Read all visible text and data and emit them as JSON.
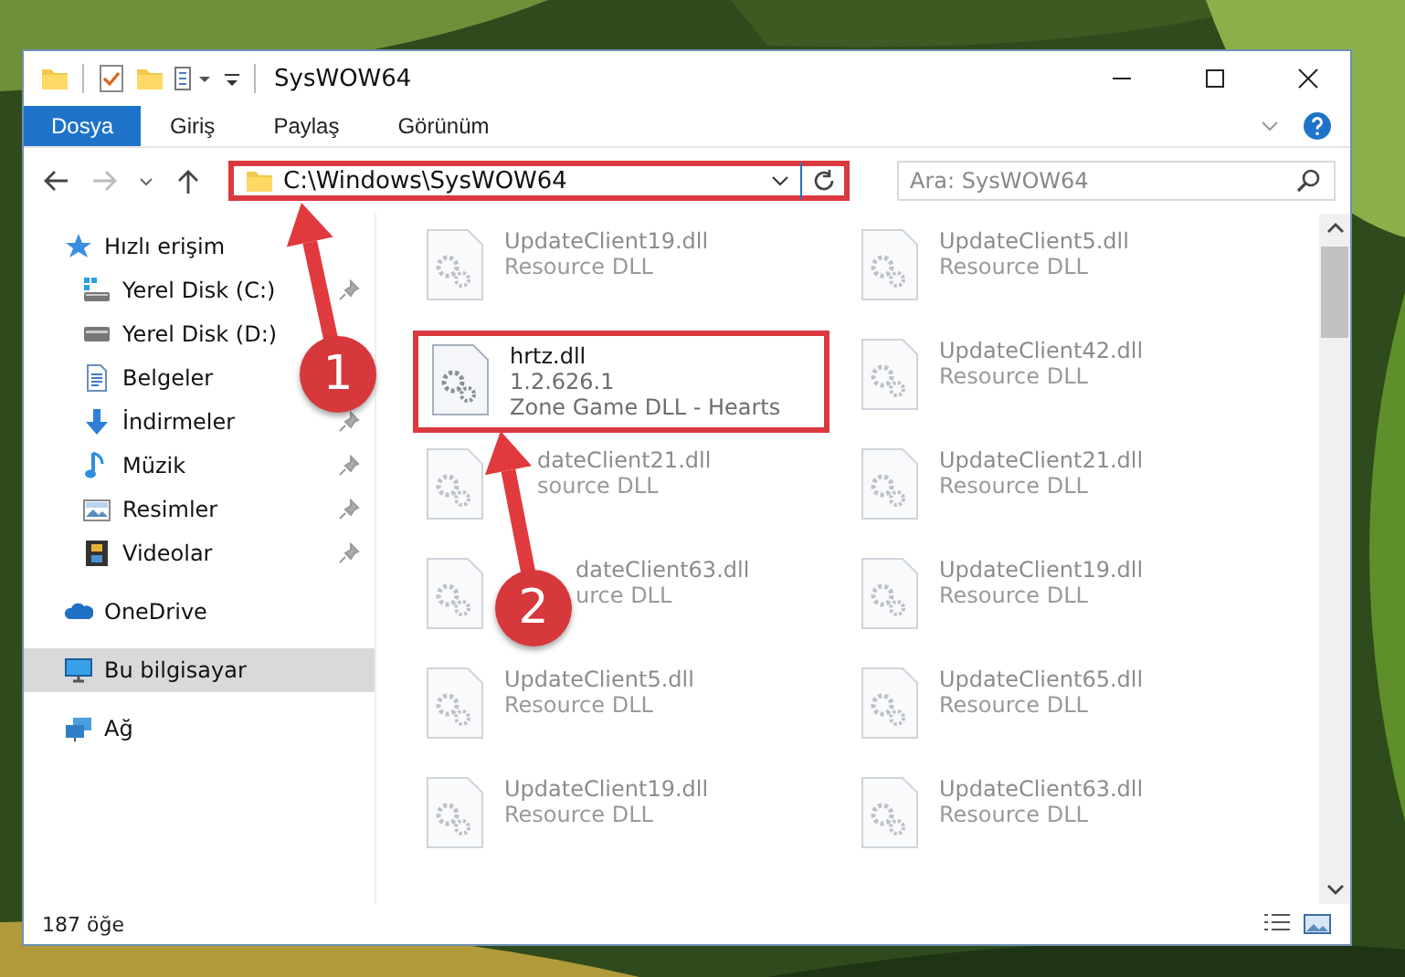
{
  "window": {
    "title": "SysWOW64"
  },
  "ribbon_tabs": [
    {
      "label": "Dosya",
      "selected": true
    },
    {
      "label": "Giriş",
      "selected": false
    },
    {
      "label": "Paylaş",
      "selected": false
    },
    {
      "label": "Görünüm",
      "selected": false
    }
  ],
  "address_bar": {
    "path": "C:\\Windows\\SysWOW64",
    "marked": true
  },
  "search": {
    "placeholder": "Ara: SysWOW64"
  },
  "sidebar": {
    "items": [
      {
        "label": "Hızlı erişim",
        "kind": "star",
        "pinned": false,
        "selected": false,
        "children": [
          {
            "label": "Yerel Disk (C:)",
            "kind": "windrive",
            "pinned": true,
            "selected": false
          },
          {
            "label": "Yerel Disk (D:)",
            "kind": "drive",
            "pinned": false,
            "selected": false
          },
          {
            "label": "Belgeler",
            "kind": "document",
            "pinned": false,
            "selected": false
          },
          {
            "label": "İndirmeler",
            "kind": "download",
            "pinned": true,
            "selected": false
          },
          {
            "label": "Müzik",
            "kind": "music",
            "pinned": true,
            "selected": false
          },
          {
            "label": "Resimler",
            "kind": "pictures",
            "pinned": true,
            "selected": false
          },
          {
            "label": "Videolar",
            "kind": "video",
            "pinned": true,
            "selected": false
          }
        ]
      },
      {
        "label": "OneDrive",
        "kind": "cloud",
        "pinned": false,
        "selected": false
      },
      {
        "label": "Bu bilgisayar",
        "kind": "computer",
        "pinned": false,
        "selected": true
      },
      {
        "label": "Ağ",
        "kind": "network",
        "pinned": false,
        "selected": false
      }
    ]
  },
  "files": [
    {
      "name": "UpdateClient19.dll",
      "lines": [
        "Resource DLL"
      ],
      "faded": true,
      "marked": false
    },
    {
      "name": "UpdateClient5.dll",
      "lines": [
        "Resource DLL"
      ],
      "faded": true,
      "marked": false
    },
    {
      "name": "hrtz.dll",
      "lines": [
        "1.2.626.1",
        "Zone Game DLL - Hearts"
      ],
      "faded": false,
      "marked": true
    },
    {
      "name": "UpdateClient42.dll",
      "lines": [
        "Resource DLL"
      ],
      "faded": true,
      "marked": false
    },
    {
      "name": "dateClient21.dll",
      "lines": [
        "source DLL"
      ],
      "faded": true,
      "marked": false
    },
    {
      "name": "UpdateClient21.dll",
      "lines": [
        "Resource DLL"
      ],
      "faded": true,
      "marked": false
    },
    {
      "name": "dateClient63.dll",
      "lines": [
        "urce DLL"
      ],
      "faded": true,
      "marked": false
    },
    {
      "name": "UpdateClient19.dll",
      "lines": [
        "Resource DLL"
      ],
      "faded": true,
      "marked": false
    },
    {
      "name": "UpdateClient5.dll",
      "lines": [
        "Resource DLL"
      ],
      "faded": true,
      "marked": false
    },
    {
      "name": "UpdateClient65.dll",
      "lines": [
        "Resource DLL"
      ],
      "faded": true,
      "marked": false
    },
    {
      "name": "UpdateClient19.dll",
      "lines": [
        "Resource DLL"
      ],
      "faded": true,
      "marked": false
    },
    {
      "name": "UpdateClient63.dll",
      "lines": [
        "Resource DLL"
      ],
      "faded": true,
      "marked": false
    }
  ],
  "status_bar": {
    "count": "187 öğe"
  },
  "annotations": [
    {
      "number": "1"
    },
    {
      "number": "2"
    }
  ]
}
